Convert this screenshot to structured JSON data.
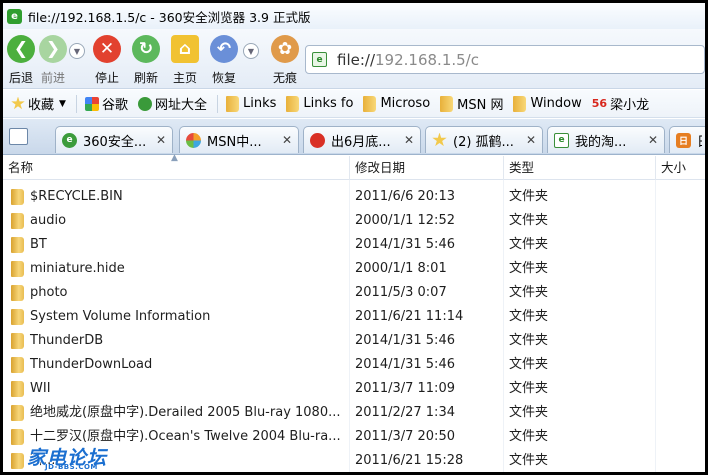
{
  "window": {
    "title": "file://192.168.1.5/c - 360安全浏览器 3.9 正式版",
    "app_icon": "360-browser-icon"
  },
  "nav": {
    "back": "后退",
    "forward": "前进",
    "stop": "停止",
    "refresh": "刷新",
    "home": "主页",
    "restore": "恢复",
    "incognito": "无痕"
  },
  "address": {
    "scheme": "file://",
    "host_path": "192.168.1.5/c"
  },
  "bookmarks": {
    "favorites": "收藏",
    "items": [
      "谷歌",
      "网址大全",
      "Links",
      "Links fo",
      "Microso",
      "MSN 网",
      "Window",
      "梁小龙"
    ]
  },
  "tabs": [
    "360安全...",
    "MSN中...",
    "出6月底...",
    "(2) 孤鹤...",
    "我的淘...",
    "日"
  ],
  "list": {
    "columns": {
      "name": "名称",
      "date": "修改日期",
      "type": "类型",
      "size": "大小"
    },
    "rows": [
      {
        "name": "$RECYCLE.BIN",
        "date": "2011/6/6 20:13",
        "type": "文件夹"
      },
      {
        "name": "audio",
        "date": "2000/1/1 12:52",
        "type": "文件夹"
      },
      {
        "name": "BT",
        "date": "2014/1/31 5:46",
        "type": "文件夹"
      },
      {
        "name": "miniature.hide",
        "date": "2000/1/1 8:01",
        "type": "文件夹"
      },
      {
        "name": "photo",
        "date": "2011/5/3 0:07",
        "type": "文件夹"
      },
      {
        "name": "System Volume Information",
        "date": "2011/6/21 11:14",
        "type": "文件夹"
      },
      {
        "name": "ThunderDB",
        "date": "2014/1/31 5:46",
        "type": "文件夹"
      },
      {
        "name": "ThunderDownLoad",
        "date": "2014/1/31 5:46",
        "type": "文件夹"
      },
      {
        "name": "WII",
        "date": "2011/3/7 11:09",
        "type": "文件夹"
      },
      {
        "name": "绝地威龙(原盘中字).Derailed 2005 Blu-ray 1080...",
        "date": "2011/2/27 1:34",
        "type": "文件夹"
      },
      {
        "name": "十二罗汉(原盘中字).Ocean's Twelve 2004 Blu-ra...",
        "date": "2011/3/7 20:50",
        "type": "文件夹"
      },
      {
        "name": "新...",
        "date": "2011/6/21 15:28",
        "type": "文件夹"
      }
    ]
  },
  "watermark": {
    "main": "家电论坛",
    "sub": "JD-BBS.COM"
  },
  "colors": {
    "accent": "#2f9e2f",
    "folder": "#e8b03a",
    "stop_red": "#e2412f",
    "watermark": "#1b6fd0"
  }
}
